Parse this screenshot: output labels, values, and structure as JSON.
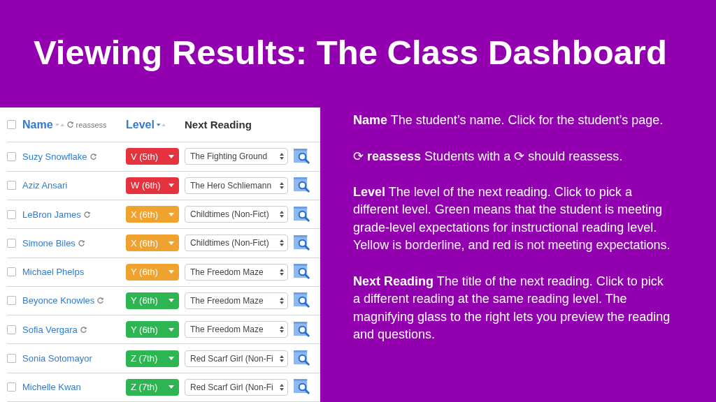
{
  "title": "Viewing Results: The Class Dashboard",
  "table": {
    "select_all_checked": false,
    "columns": {
      "name": "Name",
      "reassess": "reassess",
      "level": "Level",
      "next_reading": "Next Reading"
    },
    "rows": [
      {
        "name": "Suzy Snowflake",
        "reassess": true,
        "checked": false,
        "level": "V (5th)",
        "color": "#e5323f",
        "reading": "The Fighting Ground"
      },
      {
        "name": "Aziz Ansari",
        "reassess": false,
        "checked": false,
        "level": "W (6th)",
        "color": "#e5323f",
        "reading": "The Hero Schliemann"
      },
      {
        "name": "LeBron James",
        "reassess": true,
        "checked": false,
        "level": "X (6th)",
        "color": "#f0a22e",
        "reading": "Childtimes (Non-Fict)"
      },
      {
        "name": "Simone Biles",
        "reassess": true,
        "checked": false,
        "level": "X (6th)",
        "color": "#f0a22e",
        "reading": "Childtimes (Non-Fict)"
      },
      {
        "name": "Michael Phelps",
        "reassess": false,
        "checked": false,
        "level": "Y (6th)",
        "color": "#f0a22e",
        "reading": "The Freedom Maze"
      },
      {
        "name": "Beyonce Knowles",
        "reassess": true,
        "checked": false,
        "level": "Y (6th)",
        "color": "#2db552",
        "reading": "The Freedom Maze"
      },
      {
        "name": "Sofia Vergara",
        "reassess": true,
        "checked": false,
        "level": "Y (6th)",
        "color": "#2db552",
        "reading": "The Freedom Maze"
      },
      {
        "name": "Sonia Sotomayor",
        "reassess": false,
        "checked": false,
        "level": "Z (7th)",
        "color": "#2db552",
        "reading": "Red Scarf Girl (Non-Fi"
      },
      {
        "name": "Michelle Kwan",
        "reassess": false,
        "checked": false,
        "level": "Z (7th)",
        "color": "#2db552",
        "reading": "Red Scarf Girl (Non-Fi"
      }
    ]
  },
  "notes": [
    "**Name** The student’s name. Click for the student’s page.",
    "⟳ **reassess** Students with a ⟳ should reassess.",
    "**Level** The level of the next reading. Click to pick a different level. Green means that the student is meeting grade-level expectations for instructional reading level. Yellow is borderline, and red is not meeting expectations.",
    "**Next Reading** The title of the next reading. Click to pick a different reading at the same reading level. The magnifying glass to the right lets you preview the reading and questions."
  ]
}
